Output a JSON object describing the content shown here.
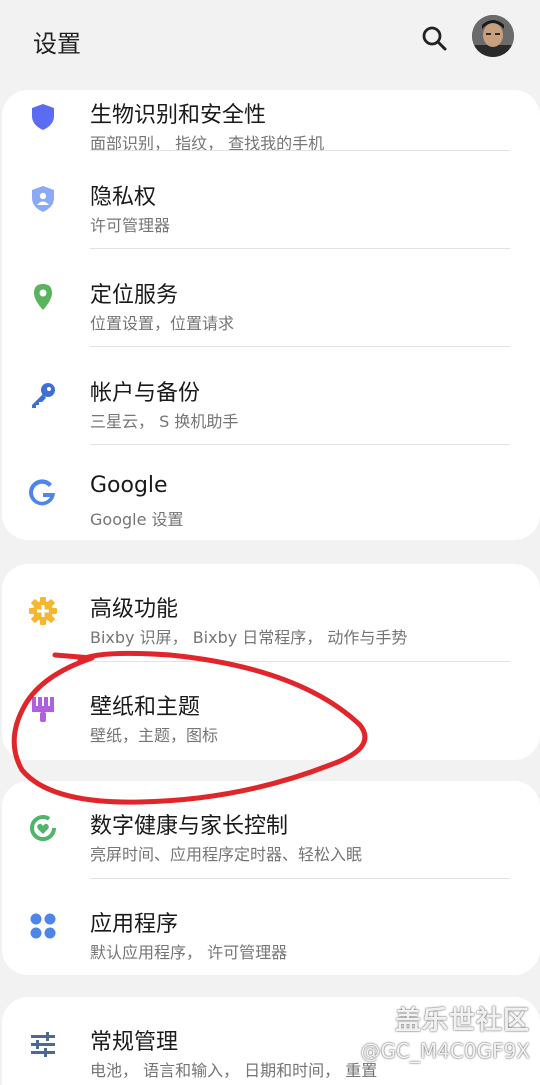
{
  "header": {
    "title": "设置"
  },
  "groups": [
    {
      "items": [
        {
          "label": "生物识别和安全性",
          "sub": "面部识别， 指纹， 查找我的手机",
          "icon": "shield-lock-icon"
        },
        {
          "label": "隐私权",
          "sub": "许可管理器",
          "icon": "privacy-shield-icon"
        },
        {
          "label": "定位服务",
          "sub": "位置设置，位置请求",
          "icon": "location-pin-icon"
        },
        {
          "label": "帐户与备份",
          "sub": "三星云， S 换机助手",
          "icon": "key-icon"
        },
        {
          "label": "Google",
          "sub": "Google 设置",
          "icon": "google-icon"
        }
      ]
    },
    {
      "items": [
        {
          "label": "高级功能",
          "sub": "Bixby 识屏， Bixby 日常程序， 动作与手势",
          "icon": "gear-plus-icon"
        },
        {
          "label": "壁纸和主题",
          "sub": "壁纸，主题，图标",
          "icon": "paintbrush-icon"
        }
      ]
    },
    {
      "items": [
        {
          "label": "数字健康与家长控制",
          "sub": "亮屏时间、应用程序定时器、轻松入眠",
          "icon": "digital-wellbeing-icon"
        },
        {
          "label": "应用程序",
          "sub": "默认应用程序， 许可管理器",
          "icon": "apps-grid-icon"
        }
      ]
    },
    {
      "items": [
        {
          "label": "常规管理",
          "sub": "电池， 语言和输入， 日期和时间， 重置",
          "icon": "sliders-icon"
        }
      ]
    }
  ],
  "watermark": {
    "brand": "盖乐世社区",
    "user": "@GC_M4C0GF9X"
  },
  "colors": {
    "background": "#f2f2f2",
    "card": "#ffffff",
    "annotation_red": "#e0262a",
    "security_icon": "#5b6cf2",
    "privacy_icon": "#6c93f5",
    "location_icon": "#5bb35e",
    "account_icon": "#3e6fd3",
    "advanced_icon": "#f5b731",
    "wallpaper_icon": "#b05fe0",
    "wellbeing_icon": "#4eb56b",
    "apps_icon": "#4d86e8",
    "general_icon": "#4c6a8f"
  }
}
